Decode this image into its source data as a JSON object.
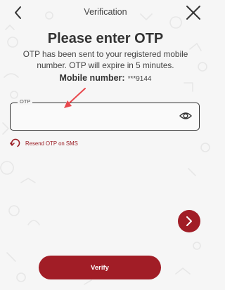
{
  "header": {
    "title": "Verification",
    "back_icon": "chevron-left-icon",
    "close_icon": "close-icon"
  },
  "main": {
    "title": "Please enter OTP",
    "subtitle": "OTP has been sent to your registered mobile number. OTP will expire in 5 minutes.",
    "mobile_label": "Mobile number:",
    "mobile_value": "***9144"
  },
  "otp_field": {
    "label": "OTP",
    "value": "",
    "placeholder": "",
    "toggle_icon": "eye-icon"
  },
  "resend": {
    "label": "Resend OTP on SMS",
    "icon": "refresh-icon"
  },
  "actions": {
    "next_icon": "chevron-right-icon",
    "verify_label": "Verify"
  },
  "colors": {
    "brand": "#a11d26",
    "background": "#f6f6f6",
    "text": "#333333",
    "annotation_arrow": "#e8484d"
  }
}
